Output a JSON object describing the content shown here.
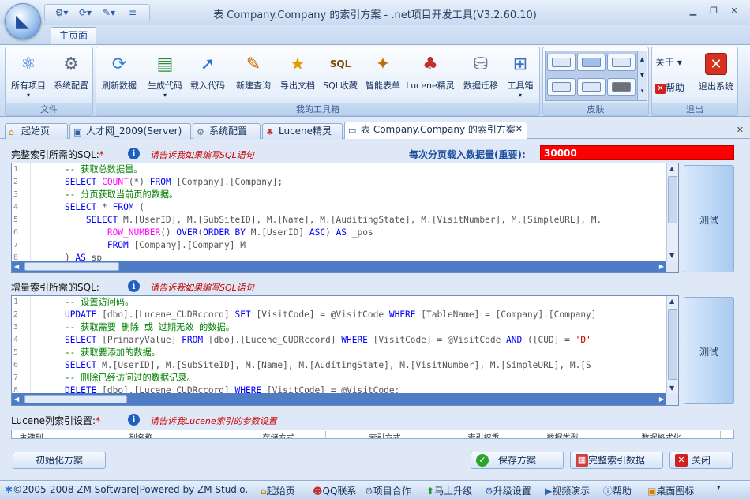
{
  "window": {
    "title": "表 Company.Company 的索引方案 - .net项目开发工具(V3.2.60.10)"
  },
  "ribbon": {
    "tab": "主页面",
    "groups": [
      {
        "label": "文件",
        "buttons": [
          "所有项目",
          "系统配置"
        ]
      },
      {
        "label": "我的工具箱",
        "buttons": [
          "刷新数据",
          "生成代码",
          "载入代码",
          "新建查询",
          "导出文档",
          "SQL收藏",
          "智能表单",
          "Lucene精灵",
          "数据迁移",
          "工具箱"
        ]
      },
      {
        "label": "皮肤"
      },
      {
        "label": "退出",
        "buttons": [
          "关于",
          "帮助",
          "退出系统"
        ]
      }
    ]
  },
  "tabs": [
    "起始页",
    "人才网_2009(Server)",
    "系统配置",
    "Lucene精灵",
    "表 Company.Company 的索引方案"
  ],
  "full_index": {
    "label": "完整索引所需的SQL:",
    "required": "*",
    "hint": "请告诉我如果编写SQL语句",
    "page_size_label": "每次分页载入数据量(重要):",
    "page_size": "30000",
    "test_label": "测试",
    "line_numbers": [
      "1",
      "2",
      "3",
      "4",
      "5",
      "6",
      "7",
      "8"
    ],
    "lines": [
      "    -- 获取总数据量。",
      "    SELECT COUNT(*) FROM [Company].[Company];",
      "    -- 分页获取当前页的数据。",
      "    SELECT * FROM (",
      "        SELECT M.[UserID], M.[SubSiteID], M.[Name], M.[AuditingState], M.[VisitNumber], M.[SimpleURL], M.",
      "            ROW_NUMBER() OVER(ORDER BY M.[UserID] ASC) AS _pos",
      "            FROM [Company].[Company] M",
      "    ) AS sp"
    ]
  },
  "incremental_index": {
    "label": "增量索引所需的SQL:",
    "hint": "请告诉我如果编写SQL语句",
    "test_label": "测试",
    "line_numbers": [
      "1",
      "2",
      "3",
      "4",
      "5",
      "6",
      "7",
      "8"
    ],
    "lines": [
      "    -- 设置访问码。",
      "    UPDATE [dbo].[Lucene_CUDRccord] SET [VisitCode] = @VisitCode WHERE [TableName] = [Company].[Company]",
      "    -- 获取需要 删除 或 过期无效 的数据。",
      "    SELECT [PrimaryValue] FROM [dbo].[Lucene_CUDRccord] WHERE [VisitCode] = @VisitCode AND ([CUD] = 'D'",
      "    -- 获取要添加的数据。",
      "    SELECT M.[UserID], M.[SubSiteID], M.[Name], M.[AuditingState], M.[VisitNumber], M.[SimpleURL], M.[S",
      "    -- 删除已经访问过的数据记录。",
      "    DELETE [dbo].[Lucene_CUDRccord] WHERE [VisitCode] = @VisitCode;"
    ]
  },
  "lucene": {
    "label": "Lucene列索引设置:",
    "required": "*",
    "hint": "请告诉我Lucene索引的参数设置",
    "columns": [
      "主键列",
      "列名称",
      "存储方式",
      "索引方式",
      "索引权重",
      "数据类型",
      "数据格式化"
    ]
  },
  "actions": {
    "init": "初始化方案",
    "save": "保存方案",
    "complete": "完整索引数据",
    "close": "关闭"
  },
  "statusbar": {
    "copyright": "©2005-2008 ZM Software|Powered by ZM Studio.",
    "items": [
      "起始页",
      "QQ联系",
      "项目合作",
      "马上升级",
      "升级设置",
      "视频演示",
      "帮助",
      "桌面图标"
    ]
  }
}
